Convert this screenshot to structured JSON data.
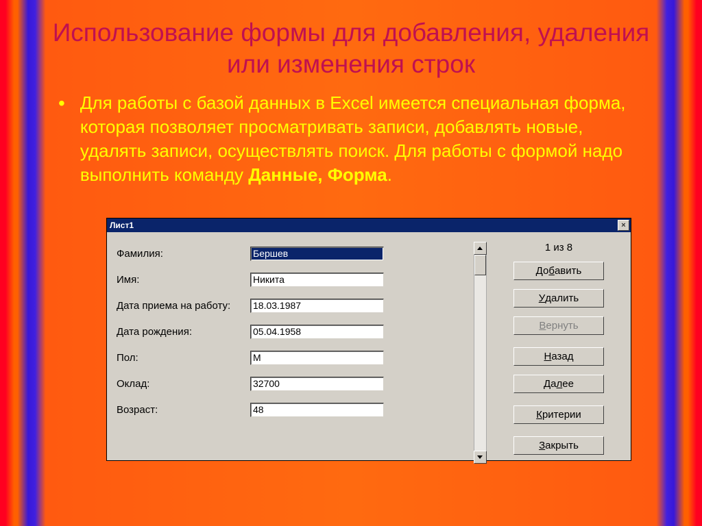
{
  "title": "Использование формы для добавления, удаления или изменения строк",
  "paragraph_main": "Для работы с базой данных в Excel имеется специальная форма, которая позволяет просматривать записи, добавлять новые, удалять записи, осуществлять поиск. Для работы с формой надо выполнить команду ",
  "paragraph_bold": "Данные, Форма",
  "paragraph_end": ".",
  "dialog": {
    "title": "Лист1",
    "counter": "1 из 8",
    "close_symbol": "×",
    "fields": [
      {
        "label": "Фамилия:",
        "value": "Бершев",
        "selected": true
      },
      {
        "label": "Имя:",
        "value": "Никита",
        "selected": false
      },
      {
        "label": "Дата приема на работу:",
        "value": "18.03.1987",
        "selected": false
      },
      {
        "label": "Дата рождения:",
        "value": "05.04.1958",
        "selected": false
      },
      {
        "label": "Пол:",
        "value": "М",
        "selected": false
      },
      {
        "label": "Оклад:",
        "value": "32700",
        "selected": false
      },
      {
        "label": "Возраст:",
        "value": "48",
        "selected": false
      }
    ],
    "buttons": [
      {
        "label_pre": "До",
        "accel": "б",
        "label_post": "авить",
        "disabled": false,
        "name": "add"
      },
      {
        "label_pre": "",
        "accel": "У",
        "label_post": "далить",
        "disabled": false,
        "name": "delete"
      },
      {
        "label_pre": "",
        "accel": "В",
        "label_post": "ернуть",
        "disabled": true,
        "name": "restore"
      },
      {
        "label_pre": "",
        "accel": "Н",
        "label_post": "азад",
        "disabled": false,
        "name": "prev"
      },
      {
        "label_pre": "Да",
        "accel": "л",
        "label_post": "ее",
        "disabled": false,
        "name": "next"
      },
      {
        "label_pre": "",
        "accel": "К",
        "label_post": "ритерии",
        "disabled": false,
        "name": "criteria"
      },
      {
        "label_pre": "",
        "accel": "З",
        "label_post": "акрыть",
        "disabled": false,
        "name": "close"
      }
    ]
  }
}
